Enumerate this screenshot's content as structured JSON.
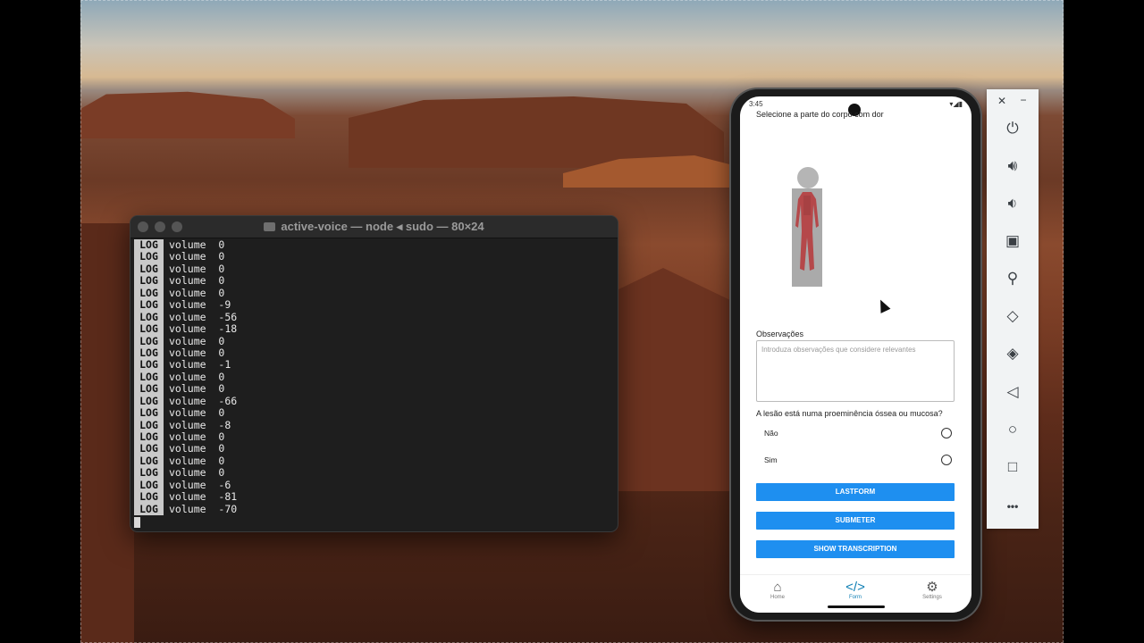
{
  "terminal": {
    "title": "active-voice — node ◂ sudo — 80×24",
    "log_tag": "LOG",
    "lines": [
      {
        "key": "volume",
        "val": "0"
      },
      {
        "key": "volume",
        "val": "0"
      },
      {
        "key": "volume",
        "val": "0"
      },
      {
        "key": "volume",
        "val": "0"
      },
      {
        "key": "volume",
        "val": "0"
      },
      {
        "key": "volume",
        "val": "-9"
      },
      {
        "key": "volume",
        "val": "-56"
      },
      {
        "key": "volume",
        "val": "-18"
      },
      {
        "key": "volume",
        "val": "0"
      },
      {
        "key": "volume",
        "val": "0"
      },
      {
        "key": "volume",
        "val": "-1"
      },
      {
        "key": "volume",
        "val": "0"
      },
      {
        "key": "volume",
        "val": "0"
      },
      {
        "key": "volume",
        "val": "-66"
      },
      {
        "key": "volume",
        "val": "0"
      },
      {
        "key": "volume",
        "val": "-8"
      },
      {
        "key": "volume",
        "val": "0"
      },
      {
        "key": "volume",
        "val": "0"
      },
      {
        "key": "volume",
        "val": "0"
      },
      {
        "key": "volume",
        "val": "0"
      },
      {
        "key": "volume",
        "val": "-6"
      },
      {
        "key": "volume",
        "val": "-81"
      },
      {
        "key": "volume",
        "val": "-70"
      }
    ]
  },
  "phone": {
    "status_time": "3:45",
    "body_prompt": "Selecione a parte do corpo com dor",
    "observations_label": "Observações",
    "observations_placeholder": "Introduza observações que considere relevantes",
    "question": "A lesão está numa proeminência óssea ou mucosa?",
    "option_no": "Não",
    "option_yes": "Sim",
    "buttons": {
      "lastform": "LASTFORM",
      "submit": "SUBMETER",
      "transcription": "SHOW TRANSCRIPTION"
    },
    "nav": {
      "home": "Home",
      "form": "Form",
      "settings": "Settings"
    }
  },
  "toolbar": {
    "close": "✕",
    "minimize": "−",
    "more": "•••"
  }
}
